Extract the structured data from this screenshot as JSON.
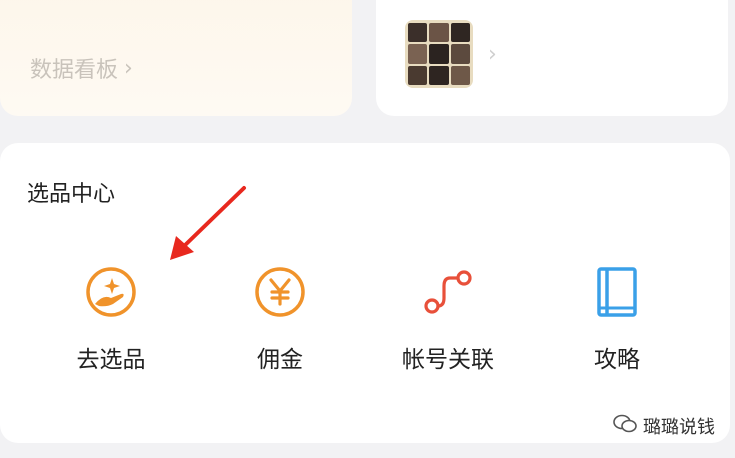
{
  "top_left_card": {
    "dashboard_label": "数据看板"
  },
  "top_right_card": {},
  "section": {
    "title": "选品中心",
    "tools": [
      {
        "label": "去选品",
        "icon": "hand-sparkle-icon"
      },
      {
        "label": "佣金",
        "icon": "yen-circle-icon"
      },
      {
        "label": "帐号关联",
        "icon": "link-nodes-icon"
      },
      {
        "label": "攻略",
        "icon": "book-icon"
      }
    ]
  },
  "watermark": {
    "text": "璐璐说钱",
    "icon": "wechat-icon"
  },
  "colors": {
    "orange": "#f0932b",
    "red": "#e8503a",
    "blue": "#3aa0e8",
    "arrow": "#e8281e"
  }
}
